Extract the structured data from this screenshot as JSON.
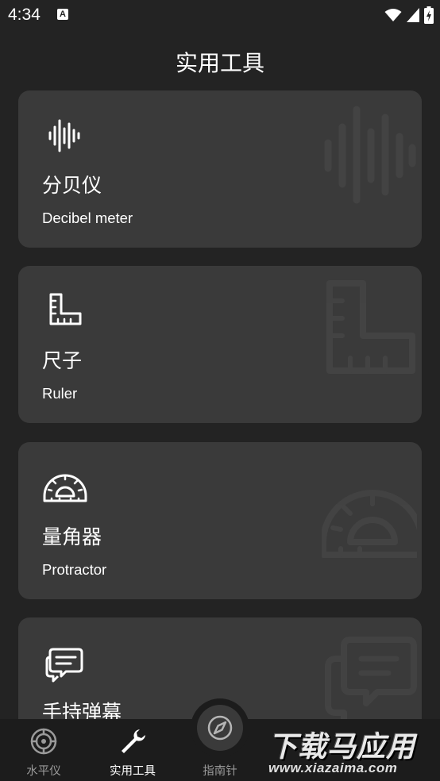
{
  "status_bar": {
    "time": "4:34",
    "notification_icon": "a-icon"
  },
  "header": {
    "title": "实用工具"
  },
  "cards": [
    {
      "title": "分贝仪",
      "subtitle": "Decibel meter",
      "icon": "sound-wave-icon"
    },
    {
      "title": "尺子",
      "subtitle": "Ruler",
      "icon": "ruler-icon"
    },
    {
      "title": "量角器",
      "subtitle": "Protractor",
      "icon": "protractor-icon"
    },
    {
      "title": "手持弹幕",
      "subtitle": "",
      "icon": "chat-bubble-icon"
    }
  ],
  "bottom_nav": {
    "items": [
      {
        "label": "水平仪",
        "icon": "level-icon",
        "active": false
      },
      {
        "label": "实用工具",
        "icon": "wrench-icon",
        "active": true
      },
      {
        "label": "指南针",
        "icon": "compass-icon",
        "active": false
      }
    ]
  },
  "watermark": {
    "text": "下载马应用",
    "url": "www.xiazaima.com"
  },
  "colors": {
    "background": "#232323",
    "card": "#3a3a3a",
    "nav": "#1c1c1c",
    "active": "#ffffff",
    "inactive": "#9a9a9a"
  }
}
